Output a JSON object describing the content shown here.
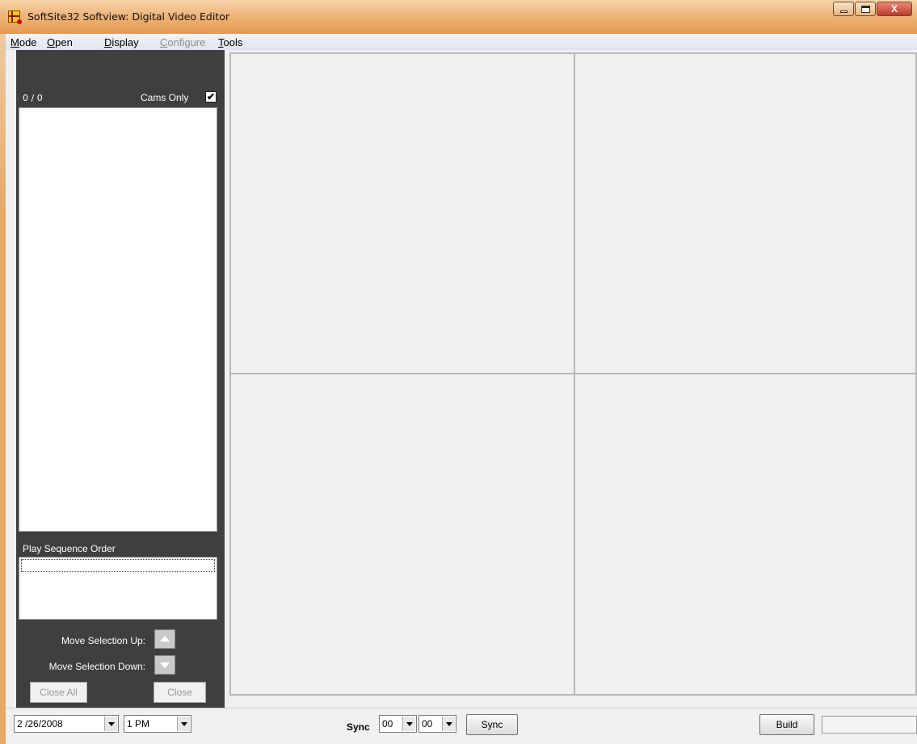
{
  "window": {
    "title": "SoftSite32 Softview: Digital Video Editor",
    "close_glyph": "X"
  },
  "menu": {
    "items": [
      {
        "label": "Mode",
        "mnemonic": "M",
        "rest": "ode",
        "enabled": true
      },
      {
        "label": "Open",
        "mnemonic": "O",
        "rest": "pen",
        "enabled": true
      },
      {
        "label": "Display",
        "mnemonic": "D",
        "rest": "isplay",
        "enabled": true
      },
      {
        "label": "Configure",
        "mnemonic": "C",
        "rest": "onfigure",
        "enabled": false
      },
      {
        "label": "Tools",
        "mnemonic": "T",
        "rest": "ools",
        "enabled": true
      }
    ]
  },
  "sidebar": {
    "count": "0 / 0",
    "cams_only_label": "Cams Only",
    "cams_only_checked": true,
    "check_glyph": "✔",
    "play_sequence_label": "Play Sequence Order",
    "move_up_label": "Move Selection Up:",
    "move_down_label": "Move Selection Down:",
    "close_all_label": "Close All",
    "close_label": "Close"
  },
  "bottom": {
    "date": "2 /26/2008",
    "hour": "1 PM",
    "sync_label": "Sync",
    "sync_hh": "00",
    "sync_mm": "00",
    "sync_button": "Sync",
    "build_button": "Build"
  },
  "colors": {
    "panel": "#3f3f3f",
    "titlebar": "#e49a52"
  }
}
